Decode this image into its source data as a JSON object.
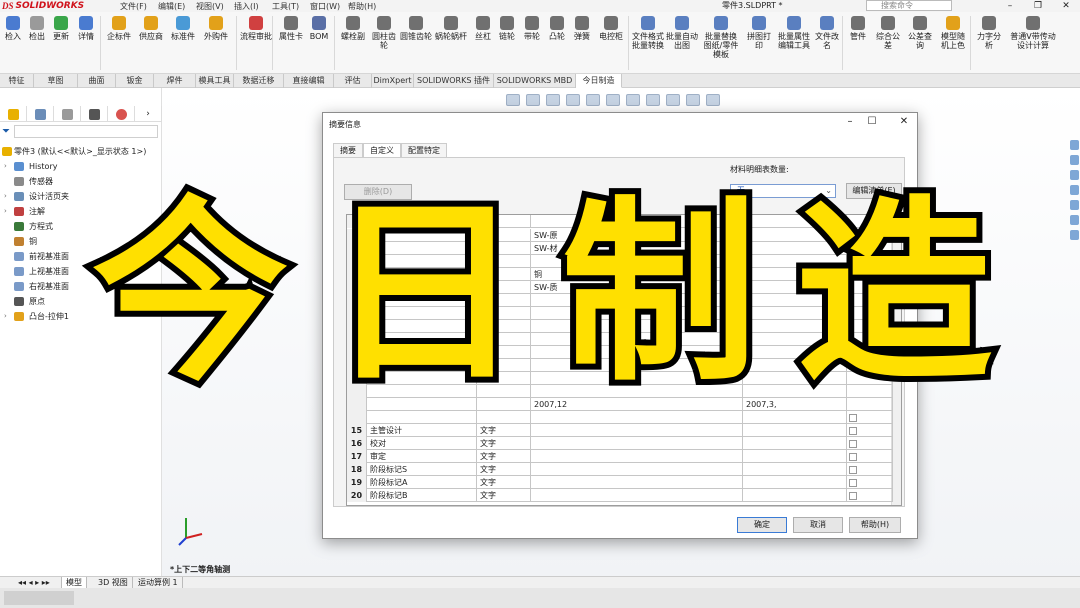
{
  "app": {
    "logo": "SOLIDWORKS",
    "menus": [
      "文件(F)",
      "编辑(E)",
      "视图(V)",
      "插入(I)",
      "工具(T)",
      "窗口(W)",
      "帮助(H)"
    ],
    "filename": "零件3.SLDPRT *",
    "search_placeholder": "搜索命令"
  },
  "ribbon": {
    "buttons": [
      {
        "label": "检入",
        "icon": "checkin-icon"
      },
      {
        "label": "检出",
        "icon": "checkout-icon"
      },
      {
        "label": "更新",
        "icon": "update-icon"
      },
      {
        "label": "详情",
        "icon": "details-icon"
      },
      {
        "label": "企标件",
        "icon": "std-part-icon"
      },
      {
        "label": "供应商",
        "icon": "supplier-icon"
      },
      {
        "label": "标准件",
        "icon": "standard-icon"
      },
      {
        "label": "外购件",
        "icon": "purchase-icon"
      },
      {
        "label": "流程审批",
        "icon": "approval-icon"
      },
      {
        "label": "属性卡",
        "icon": "property-card-icon"
      },
      {
        "label": "BOM",
        "icon": "bom-icon"
      },
      {
        "label": "螺栓副",
        "icon": "bolt-icon"
      },
      {
        "label": "圆柱齿轮",
        "icon": "spur-gear-icon"
      },
      {
        "label": "圆锥齿轮",
        "icon": "bevel-gear-icon"
      },
      {
        "label": "蜗轮蜗杆",
        "icon": "worm-gear-icon"
      },
      {
        "label": "丝杠",
        "icon": "lead-screw-icon"
      },
      {
        "label": "链轮",
        "icon": "sprocket-icon"
      },
      {
        "label": "带轮",
        "icon": "pulley-icon"
      },
      {
        "label": "凸轮",
        "icon": "cam-icon"
      },
      {
        "label": "弹簧",
        "icon": "spring-icon"
      },
      {
        "label": "电控柜",
        "icon": "cabinet-icon"
      },
      {
        "label": "文件格式批量转换",
        "icon": "convert-icon"
      },
      {
        "label": "批量自动出图",
        "icon": "auto-drawing-icon"
      },
      {
        "label": "批量替换图纸/零件模板",
        "icon": "replace-template-icon"
      },
      {
        "label": "拼图打印",
        "icon": "print-icon"
      },
      {
        "label": "批量属性编辑工具",
        "icon": "prop-edit-icon"
      },
      {
        "label": "文件改名",
        "icon": "rename-icon"
      },
      {
        "label": "管件",
        "icon": "pipe-icon"
      },
      {
        "label": "综合公差",
        "icon": "tolerance-icon"
      },
      {
        "label": "公差查询",
        "icon": "tolerance-query-icon"
      },
      {
        "label": "模型随机上色",
        "icon": "random-color-icon"
      },
      {
        "label": "力字分析",
        "icon": "force-icon"
      },
      {
        "label": "普通V带传动设计计算",
        "icon": "vbelt-icon"
      }
    ]
  },
  "tabs": [
    "特征",
    "草图",
    "曲面",
    "钣金",
    "焊件",
    "模具工具",
    "数据迁移",
    "直接编辑",
    "评估",
    "DimXpert",
    "SOLIDWORKS 插件",
    "SOLIDWORKS MBD",
    "今日制造"
  ],
  "active_tab": "今日制造",
  "tree": {
    "root": "零件3 (默认<<默认>_显示状态 1>)",
    "items": [
      {
        "label": "History",
        "icon": "history-icon",
        "indent": 1,
        "expand": true
      },
      {
        "label": "传感器",
        "icon": "sensor-icon",
        "indent": 1,
        "expand": false
      },
      {
        "label": "设计活页夹",
        "icon": "binder-icon",
        "indent": 1,
        "expand": true
      },
      {
        "label": "注解",
        "icon": "annotation-icon",
        "indent": 1,
        "expand": true
      },
      {
        "label": "方程式",
        "icon": "equation-icon",
        "indent": 1,
        "expand": false
      },
      {
        "label": "铜",
        "icon": "material-icon",
        "indent": 1,
        "expand": false
      },
      {
        "label": "前视基准面",
        "icon": "plane-icon",
        "indent": 1,
        "expand": false
      },
      {
        "label": "上视基准面",
        "icon": "plane-icon",
        "indent": 1,
        "expand": false
      },
      {
        "label": "右视基准面",
        "icon": "plane-icon",
        "indent": 1,
        "expand": false
      },
      {
        "label": "原点",
        "icon": "origin-icon",
        "indent": 1,
        "expand": false
      },
      {
        "label": "凸台-拉伸1",
        "icon": "extrude-icon",
        "indent": 1,
        "expand": true
      }
    ]
  },
  "dialog": {
    "title": "摘要信息",
    "tabs": [
      "摘要",
      "自定义",
      "配置特定"
    ],
    "active_tab": "自定义",
    "delete_label": "删除(D)",
    "bom_label": "材料明细表数量:",
    "bom_value": "-无-",
    "edit_list_label": "编辑清单(E)",
    "rows_visible_top": [
      {
        "num": "",
        "name": "",
        "type": "",
        "value": "SW-原"
      },
      {
        "num": "",
        "name": "",
        "type": "",
        "value": "SW-材"
      },
      {
        "num": "",
        "name": "",
        "type": "",
        "value": ""
      },
      {
        "num": "",
        "name": "",
        "type": "",
        "value": "铜"
      },
      {
        "num": "",
        "name": "",
        "type": "",
        "value": "SW-质"
      }
    ],
    "rows": [
      {
        "num": "15",
        "name": "主管设计",
        "type": "文字"
      },
      {
        "num": "16",
        "name": "校对",
        "type": "文字"
      },
      {
        "num": "17",
        "name": "审定",
        "type": "文字"
      },
      {
        "num": "18",
        "name": "阶段标记S",
        "type": "文字"
      },
      {
        "num": "19",
        "name": "阶段标记A",
        "type": "文字"
      },
      {
        "num": "20",
        "name": "阶段标记B",
        "type": "文字"
      }
    ],
    "partial_value_1": "2007,12",
    "partial_value_2": "2007,3,",
    "ok": "确定",
    "cancel": "取消",
    "help": "帮助(H)"
  },
  "bottom_tabs": [
    "模型",
    "3D 视图",
    "运动算例 1"
  ],
  "view_name": "*上下二等角轴测",
  "overlay_text": [
    "今",
    "日",
    "制",
    "造"
  ]
}
